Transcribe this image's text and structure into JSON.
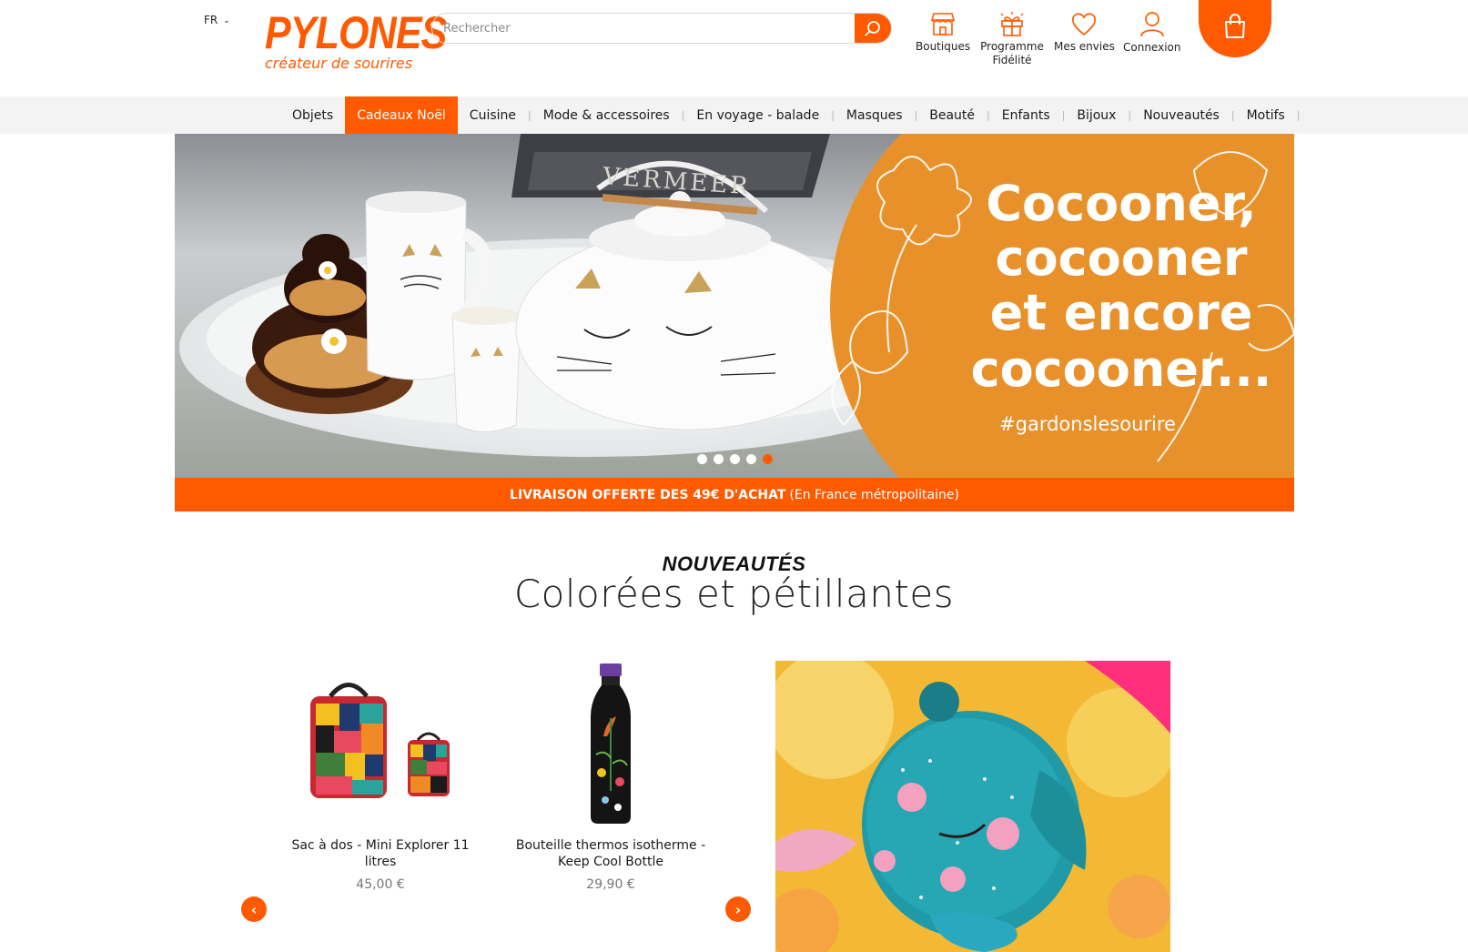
{
  "header": {
    "language": "FR",
    "logo_word": "PYLONES",
    "logo_tagline": "créateur de sourires",
    "search_placeholder": "Rechercher",
    "links": [
      {
        "label": "Boutiques",
        "icon": "shop-icon"
      },
      {
        "label": "Programme Fidélité",
        "icon": "gift-icon"
      },
      {
        "label": "Mes envies",
        "icon": "heart-icon"
      },
      {
        "label": "Connexion",
        "icon": "user-icon"
      }
    ],
    "cart_icon": "shopping-bag-icon"
  },
  "nav": {
    "items": [
      "Objets",
      "Cadeaux Noël",
      "Cuisine",
      "Mode & accessoires",
      "En voyage - balade",
      "Masques",
      "Beauté",
      "Enfants",
      "Bijoux",
      "Nouveautés",
      "Motifs"
    ],
    "active": "Cadeaux Noël"
  },
  "hero": {
    "headline_lines": [
      "Cocooner,",
      "cocooner",
      "et encore",
      "cocooner..."
    ],
    "hashtag": "#gardonslesourire",
    "book_title": "VERMEER",
    "slides": 5,
    "active_slide": 5
  },
  "promo": {
    "bold": "LIVRAISON OFFERTE DES 49€ D'ACHAT",
    "normal": "(En France métropolitaine)"
  },
  "section": {
    "kicker": "NOUVEAUTÉS",
    "title": "Colorées et pétillantes"
  },
  "products": [
    {
      "name": "Sac à dos - Mini Explorer 11 litres",
      "price": "45,00 €"
    },
    {
      "name": "Bouteille thermos isotherme - Keep Cool Bottle",
      "price": "29,90 €"
    }
  ],
  "carousel": {
    "prev": "‹",
    "next": "›"
  },
  "colors": {
    "brand": "#ff5a00",
    "nav_bg": "#f3f3f3",
    "hero_orange": "#e8912a"
  }
}
